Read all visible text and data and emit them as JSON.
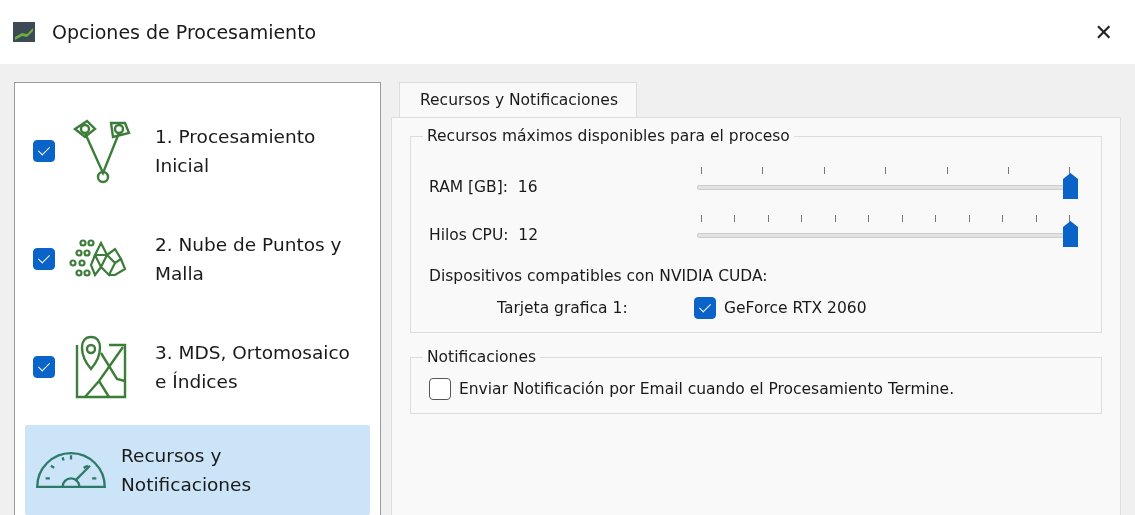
{
  "window": {
    "title": "Opciones de Procesamiento",
    "close": "✕"
  },
  "sidebar": {
    "items": [
      {
        "label": "1. Procesamiento Inicial",
        "kind": "check",
        "checked": true,
        "selected": false
      },
      {
        "label": "2. Nube de Puntos y Malla",
        "kind": "check",
        "checked": true,
        "selected": false
      },
      {
        "label": "3. MDS, Ortomosaico e Índices",
        "kind": "check",
        "checked": true,
        "selected": false
      },
      {
        "label": "Recursos y Notificaciones",
        "kind": "plain",
        "selected": true
      }
    ]
  },
  "tabs": [
    {
      "label": "Recursos y Notificaciones",
      "selected": true
    }
  ],
  "resources": {
    "title": "Recursos máximos disponibles para el proceso",
    "sliders": [
      {
        "label": "RAM [GB]:",
        "reading": "16",
        "level": 1
      },
      {
        "label": "Hilos CPU:",
        "reading": "12",
        "level": 1
      }
    ],
    "cuda_label": "Dispositivos compatibles con NVIDIA CUDA:",
    "devices": [
      {
        "label": "Tarjeta grafica 1:",
        "name": "GeForce RTX 2060",
        "checked": true
      }
    ]
  },
  "notifications": {
    "title": "Notificaciones",
    "options": [
      {
        "label": "Enviar Notificación por Email cuando el Procesamiento Termine.",
        "checked": false
      }
    ]
  }
}
